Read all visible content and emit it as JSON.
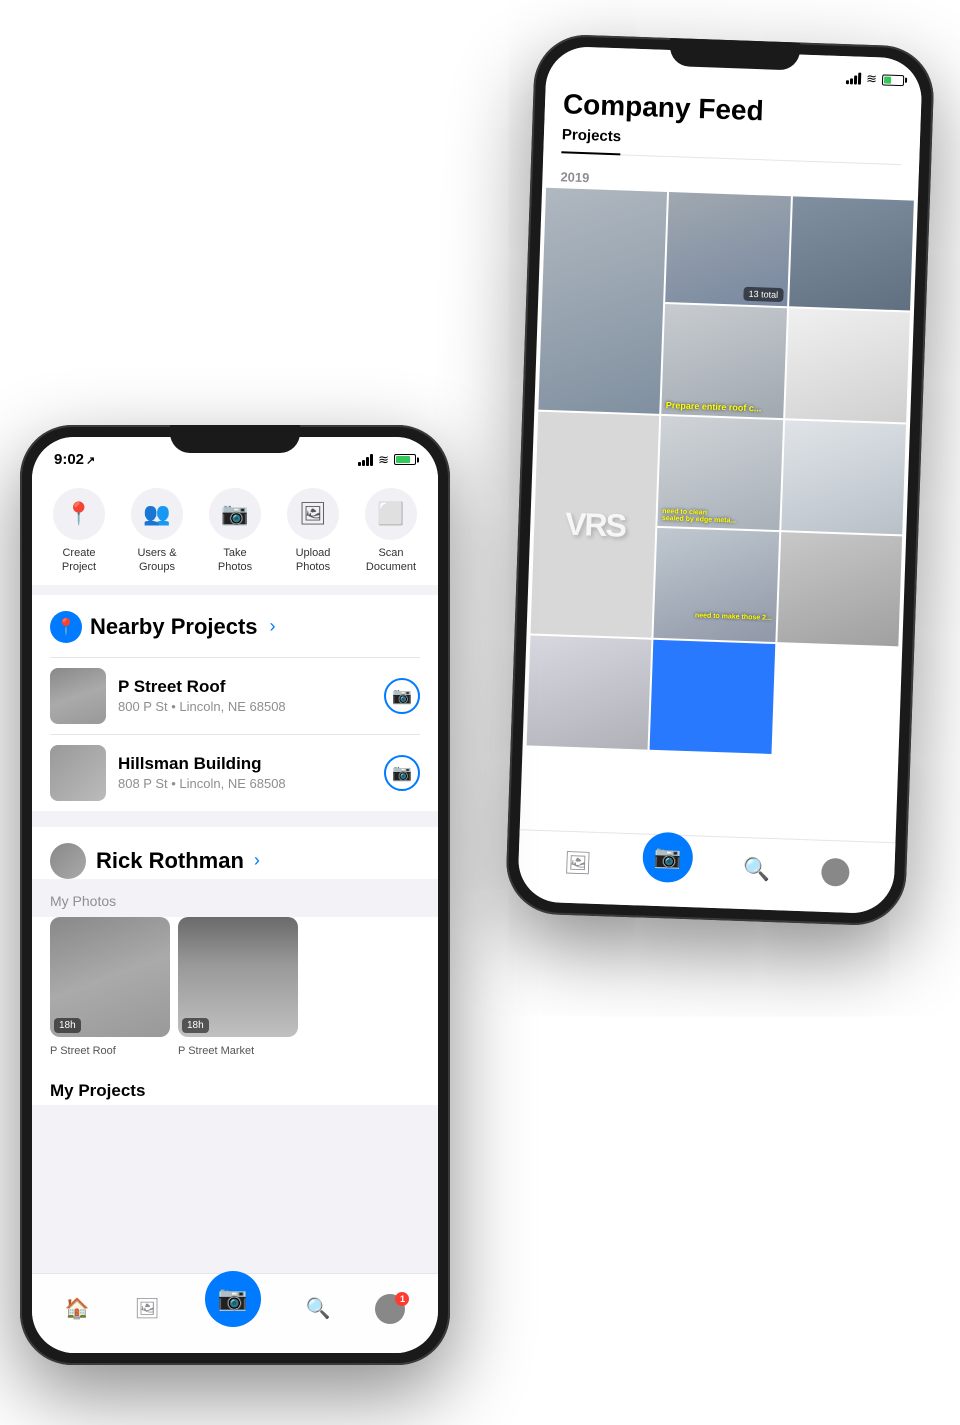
{
  "phone1": {
    "status": {
      "time": "9:02",
      "time_arrow": "↗",
      "battery_level": "85"
    },
    "quick_actions": [
      {
        "id": "create-project",
        "icon": "📍",
        "label": "Create\nProject"
      },
      {
        "id": "users-groups",
        "icon": "👥",
        "label": "Users &\nGroups"
      },
      {
        "id": "take-photos",
        "icon": "📷",
        "label": "Take\nPhotos"
      },
      {
        "id": "upload-photos",
        "icon": "🖼",
        "label": "Upload\nPhotos"
      },
      {
        "id": "scan-document",
        "icon": "⬜",
        "label": "Scan\nDocument"
      }
    ],
    "nearby": {
      "title": "Nearby Projects",
      "projects": [
        {
          "name": "P Street Roof",
          "address": "800 P St • Lincoln, NE 68508"
        },
        {
          "name": "Hillsman Building",
          "address": "808 P St • Lincoln, NE 68508"
        }
      ]
    },
    "user": {
      "name": "Rick Rothman",
      "my_photos_label": "My Photos",
      "photos": [
        {
          "badge": "18h",
          "caption": "P Street Roof"
        },
        {
          "badge": "18h",
          "caption": "P Street Market"
        }
      ],
      "my_projects_label": "My Projects"
    },
    "tabs": [
      {
        "id": "home",
        "icon": "🏠",
        "active": true
      },
      {
        "id": "gallery",
        "icon": "🖼"
      },
      {
        "id": "camera",
        "icon": "📷",
        "is_camera": true
      },
      {
        "id": "search",
        "icon": "🔍"
      },
      {
        "id": "profile",
        "icon": "👤",
        "badge": "1"
      }
    ]
  },
  "phone2": {
    "status": {
      "battery_level": "45"
    },
    "feed": {
      "title": "Company Feed",
      "tabs": [
        "Projects"
      ],
      "active_tab": "Projects",
      "date": "2019",
      "total_label": "13 total",
      "captions": [
        "Prepare entire roof c...",
        "need to clean\nsealed by edge meta...",
        "need to make those 2..."
      ]
    },
    "tabs": [
      {
        "id": "gallery",
        "icon": "🖼"
      },
      {
        "id": "camera",
        "icon": "📷",
        "is_camera": true
      },
      {
        "id": "search",
        "icon": "🔍"
      },
      {
        "id": "profile",
        "icon": "👤"
      }
    ]
  }
}
